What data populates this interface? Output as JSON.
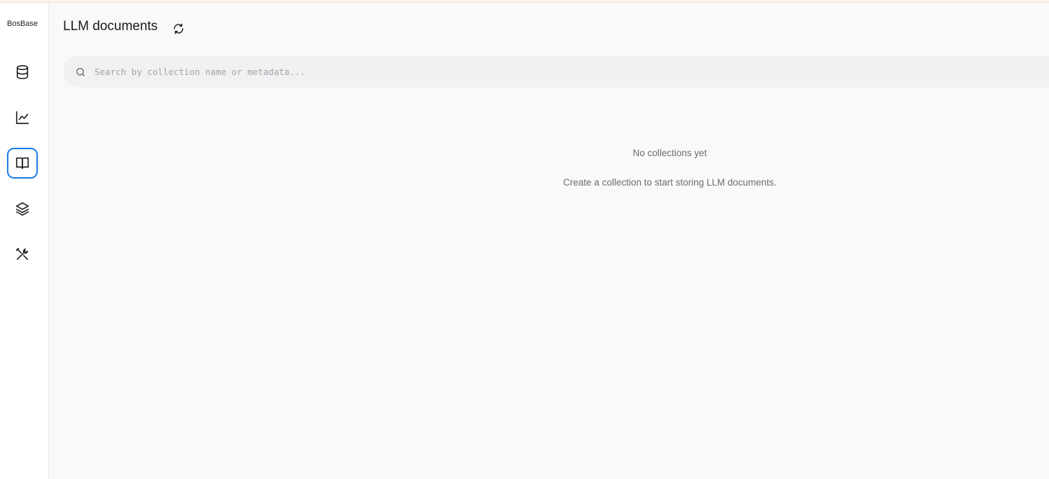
{
  "sidebar": {
    "brand": "BosBase",
    "items": [
      {
        "id": "collections",
        "icon": "database-icon",
        "active": false
      },
      {
        "id": "analytics",
        "icon": "line-chart-icon",
        "active": false
      },
      {
        "id": "llm-documents",
        "icon": "book-open-icon",
        "active": true
      },
      {
        "id": "layers",
        "icon": "layers-icon",
        "active": false
      },
      {
        "id": "tools",
        "icon": "tools-icon",
        "active": false
      }
    ]
  },
  "header": {
    "title": "LLM documents",
    "refresh_icon": "refresh-icon"
  },
  "search": {
    "placeholder": "Search by collection name or metadata...",
    "value": ""
  },
  "empty_state": {
    "title": "No collections yet",
    "description": "Create a collection to start storing LLM documents."
  },
  "colors": {
    "accent": "#1d7ae5",
    "background": "#f9f9f9",
    "search_bg": "#f1f1f3",
    "muted_text": "#6b6b6b"
  }
}
